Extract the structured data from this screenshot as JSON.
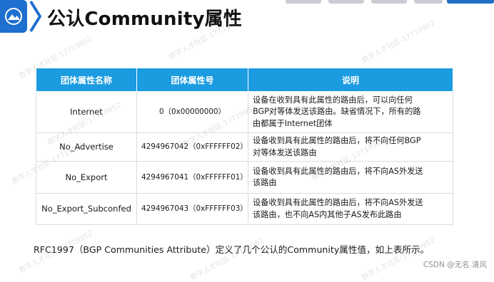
{
  "title": "公认Community属性",
  "table": {
    "headers": [
      "团体属性名称",
      "团体属性号",
      "说明"
    ],
    "rows": [
      {
        "name": "Internet",
        "code": "0（0x00000000）",
        "desc_lines": [
          "设备在收到具有此属性的路由后，可以向任何",
          "BGP对等体发送该路由。缺省情况下，所有的路",
          "由都属于Internet团体"
        ]
      },
      {
        "name": "No_Advertise",
        "code": "4294967042（0xFFFFFF02）",
        "desc_lines": [
          "设备收到具有此属性的路由后，将不向任何BGP",
          "对等体发送该路由"
        ]
      },
      {
        "name": "No_Export",
        "code": "4294967041（0xFFFFFF01）",
        "desc_lines": [
          "设备收到具有此属性的路由后，将不向AS外发送",
          "该路由"
        ]
      },
      {
        "name": "No_Export_Subconfed",
        "code": "4294967043（0xFFFFFF03）",
        "desc_lines": [
          "设备收到具有此属性的路由后，将不向AS外发送",
          "该路由，也不向AS内其他子AS发布此路由"
        ]
      }
    ]
  },
  "footer": "RFC1997（BGP Communities Attribute）定义了几个公认的Community属性值，如上表所示。",
  "watermark_text": "数字人才社区-17719952",
  "credit": "CSDN @无名.清风",
  "colors": {
    "header_bg": "#1b9be0",
    "logo_blue": "#1e6fcf",
    "tab_active": "#1f6fc5"
  }
}
